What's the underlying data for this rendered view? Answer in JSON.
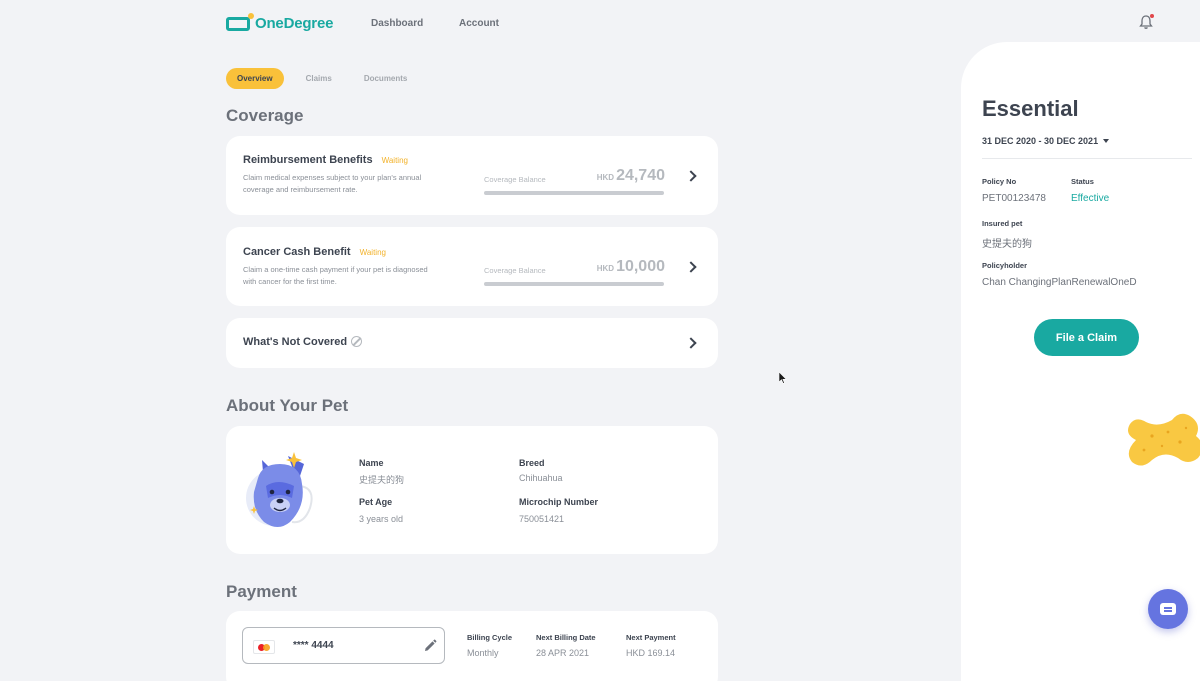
{
  "header": {
    "logo_text": "OneDegree",
    "nav": [
      "Dashboard",
      "Account"
    ]
  },
  "tabs": [
    {
      "label": "Overview",
      "active": true
    },
    {
      "label": "Claims",
      "active": false
    },
    {
      "label": "Documents",
      "active": false
    }
  ],
  "coverage": {
    "title": "Coverage",
    "reimbursement": {
      "title": "Reimbursement Benefits",
      "status": "Waiting",
      "desc": "Claim medical expenses subject to your plan's annual coverage and reimbursement rate.",
      "balance_label": "Coverage Balance",
      "currency": "HKD",
      "amount": "24,740",
      "balance_fraction": 1.0
    },
    "cancer": {
      "title": "Cancer Cash Benefit",
      "status": "Waiting",
      "desc": "Claim a one-time cash payment if your pet is diagnosed with cancer for the first time.",
      "balance_label": "Coverage Balance",
      "currency": "HKD",
      "amount": "10,000",
      "balance_fraction": 1.0
    },
    "not_covered": {
      "title": "What's Not Covered"
    }
  },
  "pet": {
    "title": "About Your Pet",
    "name_label": "Name",
    "name": "史提夫的狗",
    "breed_label": "Breed",
    "breed": "Chihuahua",
    "age_label": "Pet Age",
    "age": "3 years old",
    "microchip_label": "Microchip Number",
    "microchip": "750051421"
  },
  "payment": {
    "title": "Payment",
    "card_number": "**** 4444",
    "billing_cycle_label": "Billing Cycle",
    "billing_cycle": "Monthly",
    "next_billing_label": "Next Billing Date",
    "next_billing": "28 APR 2021",
    "next_payment_label": "Next Payment",
    "next_payment": "HKD 169.14"
  },
  "policy": {
    "plan": "Essential",
    "dates": "31 DEC 2020 - 30 DEC 2021",
    "policy_no_label": "Policy No",
    "policy_no": "PET00123478",
    "status_label": "Status",
    "status": "Effective",
    "insured_pet_label": "Insured pet",
    "insured_pet": "史提夫的狗",
    "policyholder_label": "Policyholder",
    "policyholder": "Chan ChangingPlanRenewalOneD",
    "file_claim_label": "File a Claim"
  },
  "colors": {
    "brand": "#19a9a1",
    "accent": "#f9c13a",
    "waiting": "#f2b22a",
    "chat": "#6574e0"
  },
  "icons": [
    "bell-icon",
    "chevron-right-icon",
    "ban-icon",
    "mastercard-icon",
    "pencil-icon",
    "caret-down-icon",
    "chat-icon",
    "bone-decoration"
  ]
}
